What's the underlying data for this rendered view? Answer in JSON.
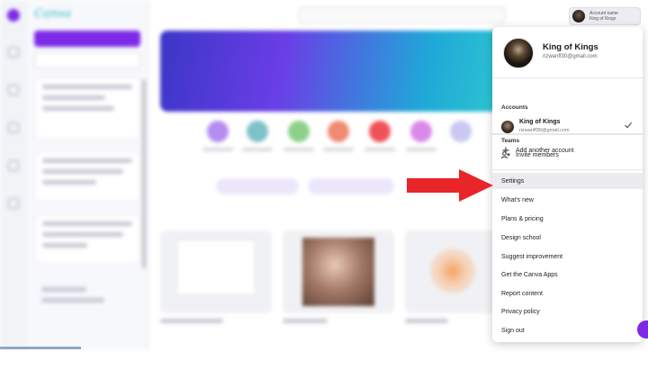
{
  "header": {
    "account_chip_line1": "Account name",
    "account_chip_line2": "King of Kings"
  },
  "account_menu": {
    "profile": {
      "name": "King of Kings",
      "email": "rizwanff30@gmail.com"
    },
    "accounts_section": {
      "title": "Accounts",
      "items": [
        {
          "name": "King of Kings",
          "email": "rizwanff30@gmail.com",
          "selected": true
        }
      ],
      "add_label": "Add another account"
    },
    "teams_section": {
      "title": "Teams",
      "invite_label": "Invite members"
    },
    "items": [
      {
        "label": "Settings",
        "highlighted": true
      },
      {
        "label": "What's new"
      },
      {
        "label": "Plans & pricing"
      },
      {
        "label": "Design school"
      },
      {
        "label": "Suggest improvement"
      },
      {
        "label": "Get the Canva Apps"
      },
      {
        "label": "Report content"
      },
      {
        "label": "Privacy policy"
      },
      {
        "label": "Sign out"
      }
    ]
  },
  "annotation": {
    "arrow_color": "#e8262a",
    "points_to": "Settings"
  },
  "colors": {
    "brand_purple": "#7d2ae8",
    "menu_highlight": "#ececf0"
  }
}
